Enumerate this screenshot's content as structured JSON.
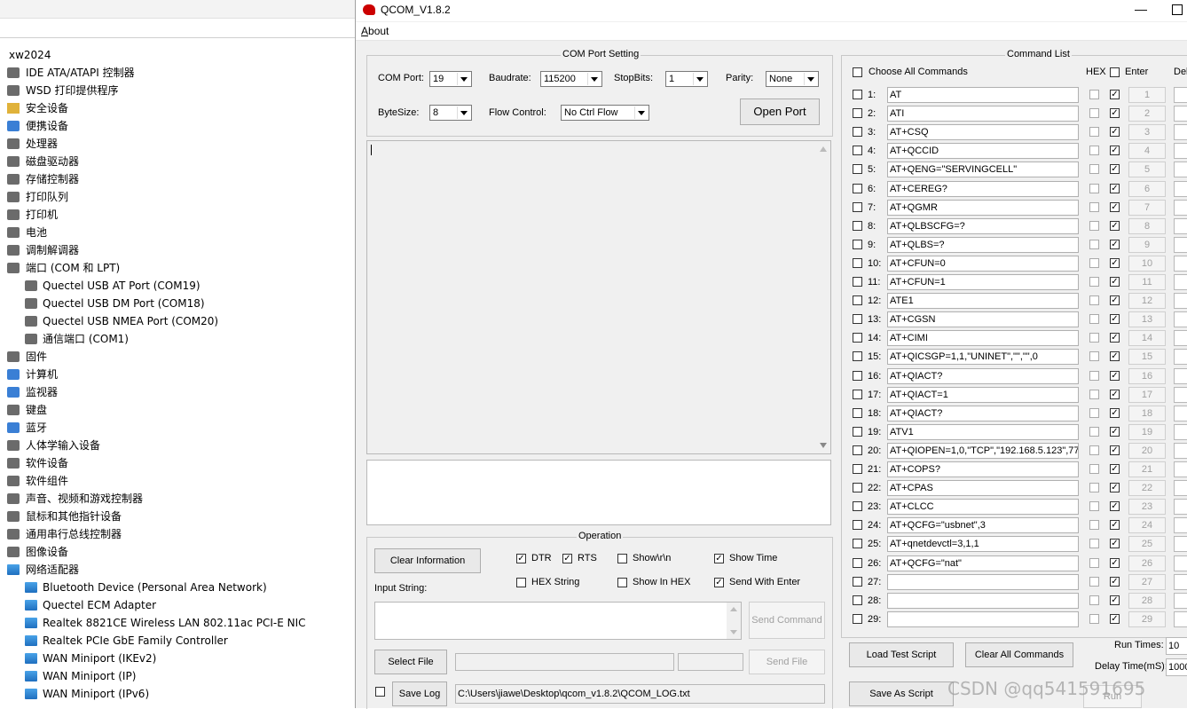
{
  "device_manager": {
    "root": "xw2024",
    "items": [
      {
        "label": "IDE ATA/ATAPI 控制器",
        "indent": 0,
        "icon": "disk-controller-icon"
      },
      {
        "label": "WSD 打印提供程序",
        "indent": 0,
        "icon": "printer-icon"
      },
      {
        "label": "安全设备",
        "indent": 0,
        "icon": "security-device-icon"
      },
      {
        "label": "便携设备",
        "indent": 0,
        "icon": "portable-device-icon"
      },
      {
        "label": "处理器",
        "indent": 0,
        "icon": "processor-icon"
      },
      {
        "label": "磁盘驱动器",
        "indent": 0,
        "icon": "disk-drive-icon"
      },
      {
        "label": "存储控制器",
        "indent": 0,
        "icon": "storage-controller-icon"
      },
      {
        "label": "打印队列",
        "indent": 0,
        "icon": "print-queue-icon"
      },
      {
        "label": "打印机",
        "indent": 0,
        "icon": "printer-icon"
      },
      {
        "label": "电池",
        "indent": 0,
        "icon": "battery-icon"
      },
      {
        "label": "调制解调器",
        "indent": 0,
        "icon": "modem-icon"
      },
      {
        "label": "端口 (COM 和 LPT)",
        "indent": 0,
        "icon": "port-icon"
      },
      {
        "label": "Quectel USB AT Port (COM19)",
        "indent": 1,
        "icon": "port-icon"
      },
      {
        "label": "Quectel USB DM Port (COM18)",
        "indent": 1,
        "icon": "port-icon"
      },
      {
        "label": "Quectel USB NMEA Port (COM20)",
        "indent": 1,
        "icon": "port-icon"
      },
      {
        "label": "通信端口 (COM1)",
        "indent": 1,
        "icon": "port-icon"
      },
      {
        "label": "固件",
        "indent": 0,
        "icon": "firmware-icon"
      },
      {
        "label": "计算机",
        "indent": 0,
        "icon": "computer-icon"
      },
      {
        "label": "监视器",
        "indent": 0,
        "icon": "monitor-icon"
      },
      {
        "label": "键盘",
        "indent": 0,
        "icon": "keyboard-icon"
      },
      {
        "label": "蓝牙",
        "indent": 0,
        "icon": "bluetooth-icon"
      },
      {
        "label": "人体学输入设备",
        "indent": 0,
        "icon": "hid-icon"
      },
      {
        "label": "软件设备",
        "indent": 0,
        "icon": "software-device-icon"
      },
      {
        "label": "软件组件",
        "indent": 0,
        "icon": "software-component-icon"
      },
      {
        "label": "声音、视频和游戏控制器",
        "indent": 0,
        "icon": "sound-icon"
      },
      {
        "label": "鼠标和其他指针设备",
        "indent": 0,
        "icon": "mouse-icon"
      },
      {
        "label": "通用串行总线控制器",
        "indent": 0,
        "icon": "usb-icon"
      },
      {
        "label": "图像设备",
        "indent": 0,
        "icon": "camera-icon"
      },
      {
        "label": "网络适配器",
        "indent": 0,
        "icon": "network-adapter-icon"
      },
      {
        "label": "Bluetooth Device (Personal Area Network)",
        "indent": 1,
        "icon": "network-adapter-icon"
      },
      {
        "label": "Quectel ECM Adapter",
        "indent": 1,
        "icon": "network-adapter-icon"
      },
      {
        "label": "Realtek 8821CE Wireless LAN 802.11ac PCI-E NIC",
        "indent": 1,
        "icon": "network-adapter-icon"
      },
      {
        "label": "Realtek PCIe GbE Family Controller",
        "indent": 1,
        "icon": "network-adapter-icon"
      },
      {
        "label": "WAN Miniport (IKEv2)",
        "indent": 1,
        "icon": "network-adapter-icon"
      },
      {
        "label": "WAN Miniport (IP)",
        "indent": 1,
        "icon": "network-adapter-icon"
      },
      {
        "label": "WAN Miniport (IPv6)",
        "indent": 1,
        "icon": "network-adapter-icon"
      }
    ]
  },
  "qcom": {
    "title": "QCOM_V1.8.2",
    "menu_about": "About",
    "com_group_title": "COM Port Setting",
    "com_port_label": "COM Port:",
    "com_port_value": "19",
    "baudrate_label": "Baudrate:",
    "baudrate_value": "115200",
    "stopbits_label": "StopBits:",
    "stopbits_value": "1",
    "parity_label": "Parity:",
    "parity_value": "None",
    "bytesize_label": "ByteSize:",
    "bytesize_value": "8",
    "flow_label": "Flow Control:",
    "flow_value": "No Ctrl Flow",
    "open_port": "Open Port",
    "operation_title": "Operation",
    "clear_information": "Clear Information",
    "dtr": "DTR",
    "rts": "RTS",
    "show_rn": "Show\\r\\n",
    "show_time": "Show Time",
    "hex_string": "HEX String",
    "show_in_hex": "Show In HEX",
    "send_with_enter": "Send With Enter",
    "input_string_label": "Input String:",
    "send_command": "Send Command",
    "select_file": "Select File",
    "send_file": "Send File",
    "save_log": "Save Log",
    "log_path": "C:\\Users\\jiawe\\Desktop\\qcom_v1.8.2\\QCOM_LOG.txt",
    "cmd_group_title": "Command List",
    "choose_all": "Choose All Commands",
    "hex_header": "HEX",
    "enter_header": "Enter",
    "delay_header": "Del",
    "commands": [
      {
        "n": "1:",
        "cmd": "AT"
      },
      {
        "n": "2:",
        "cmd": "ATI"
      },
      {
        "n": "3:",
        "cmd": "AT+CSQ"
      },
      {
        "n": "4:",
        "cmd": "AT+QCCID"
      },
      {
        "n": "5:",
        "cmd": "AT+QENG=\"SERVINGCELL\""
      },
      {
        "n": "6:",
        "cmd": "AT+CEREG?"
      },
      {
        "n": "7:",
        "cmd": "AT+QGMR"
      },
      {
        "n": "8:",
        "cmd": "AT+QLBSCFG=?"
      },
      {
        "n": "9:",
        "cmd": "AT+QLBS=?"
      },
      {
        "n": "10:",
        "cmd": "AT+CFUN=0"
      },
      {
        "n": "11:",
        "cmd": "AT+CFUN=1"
      },
      {
        "n": "12:",
        "cmd": "ATE1"
      },
      {
        "n": "13:",
        "cmd": "AT+CGSN"
      },
      {
        "n": "14:",
        "cmd": "AT+CIMI"
      },
      {
        "n": "15:",
        "cmd": "AT+QICSGP=1,1,\"UNINET\",\"\",\"\",0"
      },
      {
        "n": "16:",
        "cmd": "AT+QIACT?"
      },
      {
        "n": "17:",
        "cmd": "AT+QIACT=1"
      },
      {
        "n": "18:",
        "cmd": "AT+QIACT?"
      },
      {
        "n": "19:",
        "cmd": "ATV1"
      },
      {
        "n": "20:",
        "cmd": "AT+QIOPEN=1,0,\"TCP\",\"192.168.5.123\",77"
      },
      {
        "n": "21:",
        "cmd": "AT+COPS?"
      },
      {
        "n": "22:",
        "cmd": "AT+CPAS"
      },
      {
        "n": "23:",
        "cmd": "AT+CLCC"
      },
      {
        "n": "24:",
        "cmd": "AT+QCFG=\"usbnet\",3"
      },
      {
        "n": "25:",
        "cmd": "AT+qnetdevctl=3,1,1"
      },
      {
        "n": "26:",
        "cmd": "AT+QCFG=\"nat\""
      },
      {
        "n": "27:",
        "cmd": ""
      },
      {
        "n": "28:",
        "cmd": ""
      },
      {
        "n": "29:",
        "cmd": ""
      }
    ],
    "cmd_buttons": [
      "1",
      "2",
      "3",
      "4",
      "5",
      "6",
      "7",
      "8",
      "9",
      "10",
      "11",
      "12",
      "13",
      "14",
      "15",
      "16",
      "17",
      "18",
      "19",
      "20",
      "21",
      "22",
      "23",
      "24",
      "25",
      "26",
      "27",
      "28",
      "29"
    ],
    "load_test_script": "Load Test Script",
    "clear_all_commands": "Clear All Commands",
    "save_as_script": "Save As Script",
    "run_times_label": "Run Times:",
    "run_times_value": "10",
    "delay_time_label": "Delay Time(mS):",
    "delay_time_value": "1000",
    "run": "Run"
  },
  "watermark": "CSDN @qq541591695"
}
